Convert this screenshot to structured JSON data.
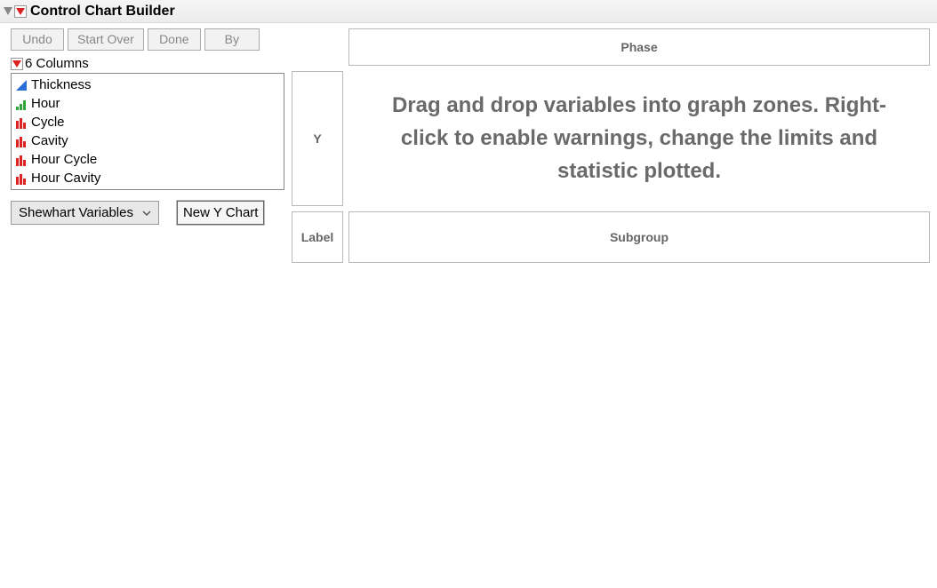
{
  "header": {
    "title": "Control Chart Builder"
  },
  "toolbar": {
    "undo": "Undo",
    "start_over": "Start Over",
    "done": "Done",
    "by": "By"
  },
  "columns": {
    "header_label": "6 Columns",
    "items": [
      {
        "name": "Thickness",
        "icon": "continuous-icon"
      },
      {
        "name": "Hour",
        "icon": "ordinal-icon"
      },
      {
        "name": "Cycle",
        "icon": "nominal-icon"
      },
      {
        "name": "Cavity",
        "icon": "nominal-icon"
      },
      {
        "name": "Hour Cycle",
        "icon": "nominal-icon"
      },
      {
        "name": "Hour Cavity",
        "icon": "nominal-icon"
      }
    ]
  },
  "controls": {
    "chart_type_selected": "Shewhart Variables",
    "new_y_chart": "New Y Chart"
  },
  "zones": {
    "phase": "Phase",
    "y": "Y",
    "label": "Label",
    "subgroup": "Subgroup"
  },
  "canvas": {
    "instruction": "Drag and drop variables into graph zones. Right-click to enable warnings, change the limits and statistic plotted."
  }
}
